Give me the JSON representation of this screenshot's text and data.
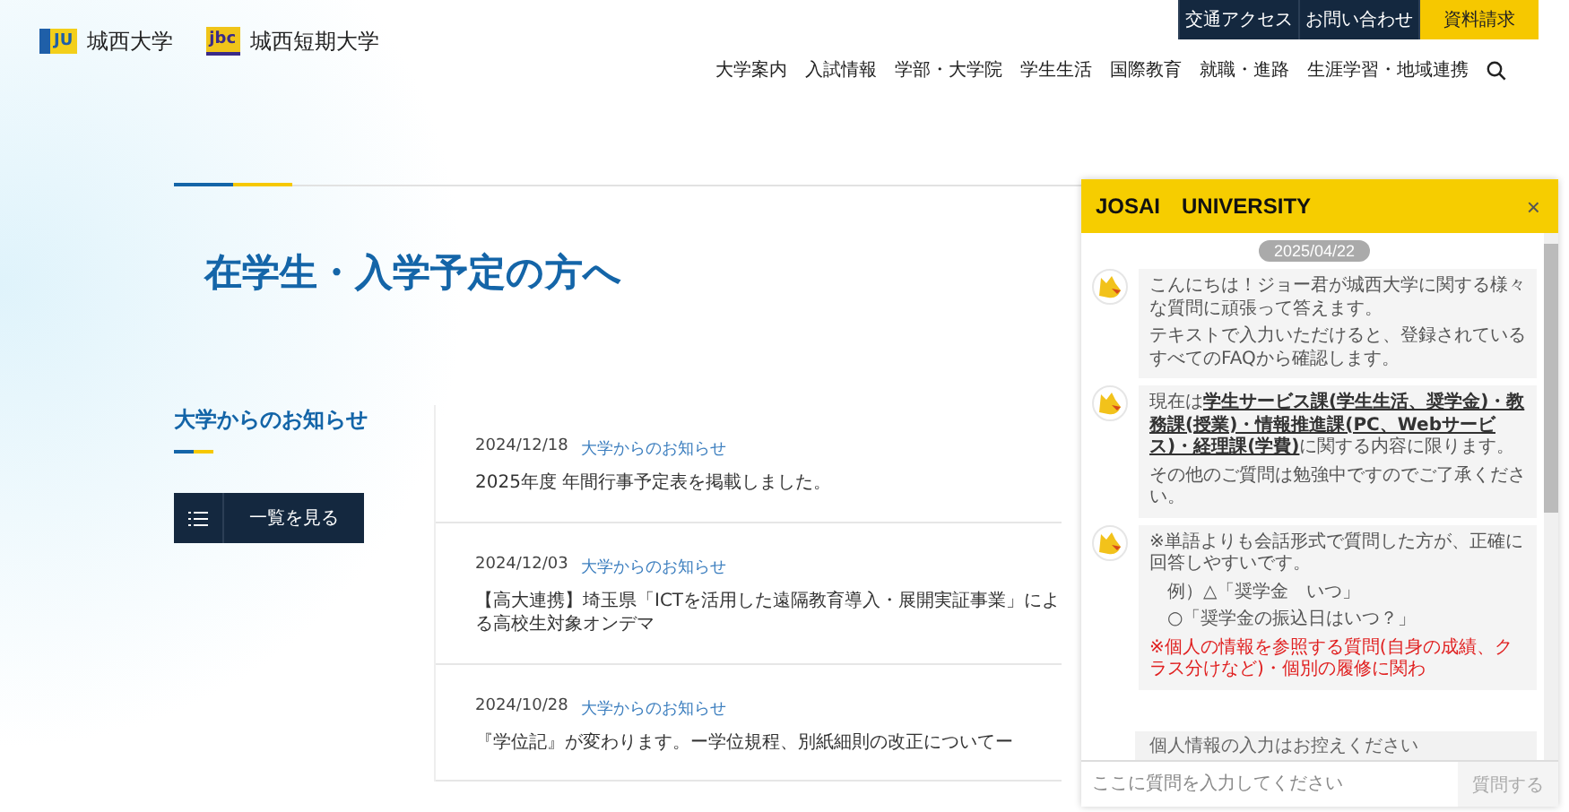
{
  "header": {
    "logos": [
      {
        "mark": "JU",
        "name": "城西大学"
      },
      {
        "mark": "jbc",
        "name": "城西短期大学"
      }
    ],
    "top_links": [
      {
        "label": "交通アクセス",
        "kind": "dark"
      },
      {
        "label": "お問い合わせ",
        "kind": "dark"
      },
      {
        "label": "資料請求",
        "kind": "accent"
      }
    ],
    "nav": [
      "大学案内",
      "入試情報",
      "学部・大学院",
      "学生生活",
      "国際教育",
      "就職・進路",
      "生涯学習・地域連携"
    ]
  },
  "page_title": "在学生・入学予定の方へ",
  "news": {
    "heading": "大学からのお知らせ",
    "list_button": "一覧を見る",
    "items": [
      {
        "date": "2024/12/18",
        "category": "大学からのお知らせ",
        "title": "2025年度 年間行事予定表を掲載しました。"
      },
      {
        "date": "2024/12/03",
        "category": "大学からのお知らせ",
        "title": "【高大連携】埼玉県「ICTを活用した遠隔教育導入・展開実証事業」による高校生対象オンデマ"
      },
      {
        "date": "2024/10/28",
        "category": "大学からのお知らせ",
        "title": "『学位記』が変わります。ー学位規程、別紙細則の改正についてー"
      }
    ]
  },
  "chat": {
    "title": "JOSAI　UNIVERSITY",
    "close": "×",
    "date": "2025/04/22",
    "messages": [
      {
        "paragraphs": [
          {
            "kind": "text",
            "text": "こんにちは！ジョー君が城西大学に関する様々な質問に頑張って答えます。"
          },
          {
            "kind": "text",
            "text": "テキストで入力いただけると、登録されているすべてのFAQから確認します。"
          }
        ]
      },
      {
        "paragraphs": [
          {
            "kind": "text",
            "text": "現在は**学生サービス課(学生生活、奨学金)・教務課(授業)・情報推進課(PC、Webサービス)・経理課(学費)**に関する内容に限ります。"
          },
          {
            "kind": "text",
            "text": "その他のご質問は勉強中ですのでご了承ください。"
          }
        ]
      },
      {
        "paragraphs": [
          {
            "kind": "text",
            "text": "※単語よりも会話形式で質問した方が、正確に回答しやすいです。"
          },
          {
            "kind": "example",
            "text": "例）△「奨学金　いつ」"
          },
          {
            "kind": "example",
            "text": "○「奨学金の振込日はいつ？」"
          },
          {
            "kind": "warning",
            "text": "※個人の情報を参照する質問(自身の成績、クラス分けなど)・個別の履修に関わ"
          }
        ]
      }
    ],
    "notice": "個人情報の入力はお控えください",
    "placeholder": "ここに質問を入力してください",
    "send": "質問する"
  }
}
